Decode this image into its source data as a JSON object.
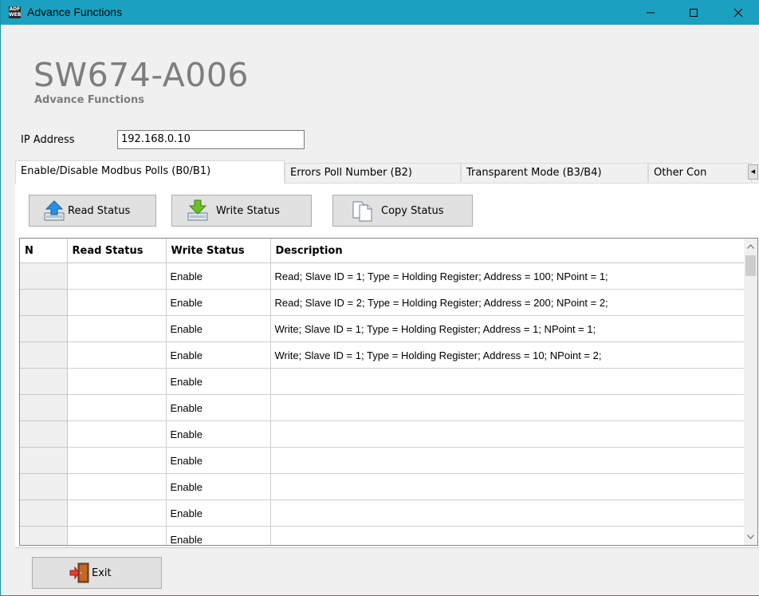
{
  "window": {
    "title": "Advance Functions",
    "app_icon_text": "ADF WEB"
  },
  "header": {
    "title": "SW674-A006",
    "subtitle": "Advance Functions"
  },
  "ip": {
    "label": "IP Address",
    "value": "192.168.0.10"
  },
  "tabs": [
    {
      "label": "Enable/Disable Modbus Polls (B0/B1)",
      "active": true
    },
    {
      "label": "Errors Poll Number (B2)",
      "active": false
    },
    {
      "label": "Transparent Mode (B3/B4)",
      "active": false
    },
    {
      "label": "Other Con",
      "active": false
    }
  ],
  "toolbar": {
    "read_label": "Read Status",
    "write_label": "Write Status",
    "copy_label": "Copy Status"
  },
  "table": {
    "columns": [
      "N",
      "Read Status",
      "Write Status",
      "Description"
    ],
    "rows": [
      {
        "n": "",
        "read": "",
        "write": "Enable",
        "desc": "Read; Slave ID = 1; Type = Holding Register; Address = 100; NPoint = 1;"
      },
      {
        "n": "",
        "read": "",
        "write": "Enable",
        "desc": "Read; Slave ID = 2; Type = Holding Register; Address = 200; NPoint = 2;"
      },
      {
        "n": "",
        "read": "",
        "write": "Enable",
        "desc": "Write; Slave ID = 1; Type = Holding Register; Address = 1; NPoint = 1;"
      },
      {
        "n": "",
        "read": "",
        "write": "Enable",
        "desc": "Write; Slave ID = 1; Type = Holding Register; Address = 10; NPoint = 2;"
      },
      {
        "n": "",
        "read": "",
        "write": "Enable",
        "desc": ""
      },
      {
        "n": "",
        "read": "",
        "write": "Enable",
        "desc": ""
      },
      {
        "n": "",
        "read": "",
        "write": "Enable",
        "desc": ""
      },
      {
        "n": "",
        "read": "",
        "write": "Enable",
        "desc": ""
      },
      {
        "n": "",
        "read": "",
        "write": "Enable",
        "desc": ""
      },
      {
        "n": "",
        "read": "",
        "write": "Enable",
        "desc": ""
      },
      {
        "n": "",
        "read": "",
        "write": "Enable",
        "desc": ""
      }
    ]
  },
  "footer": {
    "exit_label": "Exit"
  },
  "colors": {
    "titlebar": "#1ba1bf",
    "heading": "#7d7d7d"
  },
  "icons": [
    "minimize-icon",
    "maximize-icon",
    "close-icon",
    "read-status-icon",
    "write-status-icon",
    "copy-status-icon",
    "exit-door-icon",
    "scroll-up-icon",
    "scroll-down-icon",
    "tab-scroll-left-icon",
    "tab-scroll-right-icon"
  ]
}
